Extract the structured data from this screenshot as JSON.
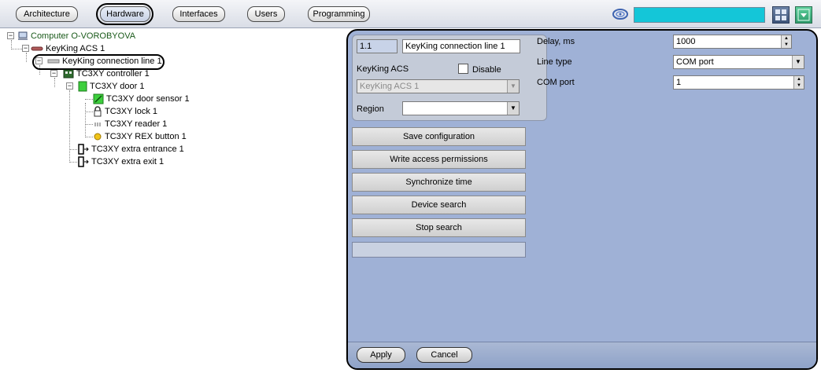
{
  "top_tabs": [
    {
      "label": "Architecture"
    },
    {
      "label": "Hardware"
    },
    {
      "label": "Interfaces"
    },
    {
      "label": "Users"
    },
    {
      "label": "Programming"
    }
  ],
  "active_tab": "Hardware",
  "tree": {
    "items": [
      {
        "label": "Computer O-VOROBYOVA",
        "icon": "computer-icon"
      },
      {
        "label": "KeyKing ACS 1",
        "icon": "acs-icon"
      },
      {
        "label": "KeyKing connection line 1",
        "icon": "connection-line-icon"
      },
      {
        "label": "TC3XY controller 1",
        "icon": "controller-icon"
      },
      {
        "label": "TC3XY door 1",
        "icon": "door-icon"
      },
      {
        "label": "TC3XY door sensor 1",
        "icon": "door-sensor-icon"
      },
      {
        "label": "TC3XY lock 1",
        "icon": "lock-icon"
      },
      {
        "label": "TC3XY reader 1",
        "icon": "reader-icon"
      },
      {
        "label": "TC3XY REX button 1",
        "icon": "rex-button-icon"
      },
      {
        "label": "TC3XY extra entrance 1",
        "icon": "entrance-icon"
      },
      {
        "label": "TC3XY extra exit 1",
        "icon": "exit-icon"
      }
    ]
  },
  "settings": {
    "id_value": "1.1",
    "name_value": "KeyKing connection line 1",
    "parent_label": "KeyKing ACS",
    "disable_label": "Disable",
    "parent_value": "KeyKing ACS 1",
    "region_label": "Region",
    "region_value": ""
  },
  "actions": {
    "save_configuration": "Save configuration",
    "write_access_permissions": "Write access permissions",
    "synchronize_time": "Synchronize time",
    "device_search": "Device search",
    "stop_search": "Stop search"
  },
  "params": {
    "delay_label": "Delay, ms",
    "delay_value": "1000",
    "line_type_label": "Line type",
    "line_type_value": "COM port",
    "com_port_label": "COM port",
    "com_port_value": "1"
  },
  "footer": {
    "apply": "Apply",
    "cancel": "Cancel"
  },
  "colors": {
    "panel_bg": "#9fb1d6",
    "status_bar": "#14c6d8",
    "tree_root_text": "#1a5a1a"
  }
}
